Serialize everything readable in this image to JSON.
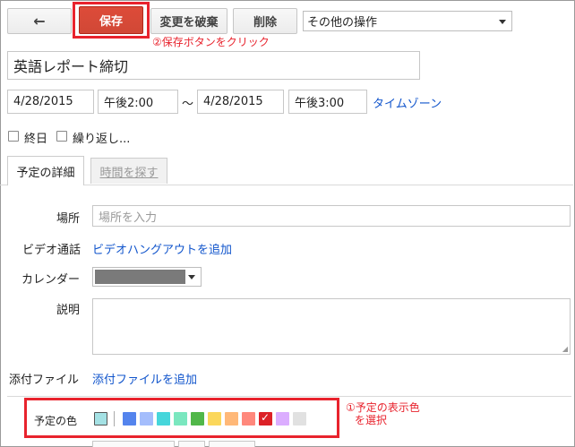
{
  "toolbar": {
    "back_label": "←",
    "save_label": "保存",
    "discard_label": "変更を破棄",
    "delete_label": "削除",
    "more_actions_label": "その他の操作"
  },
  "annotations": {
    "save_hint": "②保存ボタンをクリック",
    "color_hint_line1": "①予定の表示色",
    "color_hint_line2": "を選択"
  },
  "event": {
    "title": "英語レポート締切",
    "start_date": "4/28/2015",
    "start_time": "午後2:00",
    "range_sep": "〜",
    "end_date": "4/28/2015",
    "end_time": "午後3:00",
    "timezone_link": "タイムゾーン",
    "all_day_label": "終日",
    "repeat_label": "繰り返し..."
  },
  "tabs": {
    "details": "予定の詳細",
    "find_time": "時間を探す"
  },
  "details": {
    "location_label": "場所",
    "location_placeholder": "場所を入力",
    "video_label": "ビデオ通話",
    "video_link": "ビデオハングアウトを追加",
    "calendar_label": "カレンダー",
    "description_label": "説明",
    "attachment_label": "添付ファイル",
    "attachment_link": "添付ファイルを追加",
    "color_label": "予定の色"
  },
  "colors": {
    "default": "#a4e1e4",
    "swatches": [
      "#5484ed",
      "#a4bdfc",
      "#46d6db",
      "#7ae7bf",
      "#51b749",
      "#fbd75b",
      "#ffb878",
      "#ff887c",
      "#dc2127",
      "#dbadff",
      "#e1e1e1"
    ],
    "selected_index": 8,
    "highlight": "#e8232d"
  }
}
